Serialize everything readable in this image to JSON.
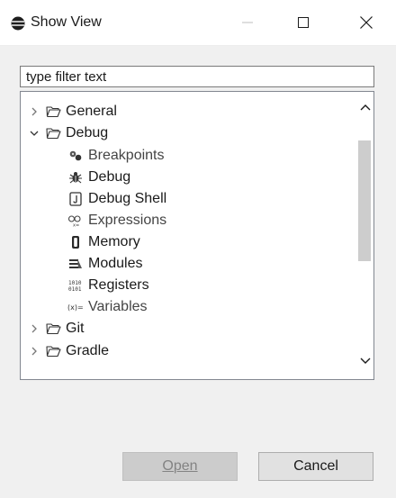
{
  "window": {
    "title": "Show View",
    "controls": {
      "minimize": "minimize",
      "maximize": "maximize",
      "close": "close"
    }
  },
  "filter": {
    "placeholder": "type filter text",
    "value": ""
  },
  "tree": {
    "items": [
      {
        "label": "General",
        "type": "folder",
        "expanded": false,
        "icon": "folder-icon"
      },
      {
        "label": "Debug",
        "type": "folder",
        "expanded": true,
        "icon": "folder-icon"
      },
      {
        "label": "Breakpoints",
        "type": "view",
        "icon": "breakpoints-icon"
      },
      {
        "label": "Debug",
        "type": "view",
        "icon": "debug-bug-icon"
      },
      {
        "label": "Debug Shell",
        "type": "view",
        "icon": "debug-shell-icon"
      },
      {
        "label": "Expressions",
        "type": "view",
        "icon": "expressions-icon"
      },
      {
        "label": "Memory",
        "type": "view",
        "icon": "memory-icon"
      },
      {
        "label": "Modules",
        "type": "view",
        "icon": "modules-icon"
      },
      {
        "label": "Registers",
        "type": "view",
        "icon": "registers-icon"
      },
      {
        "label": "Variables",
        "type": "view",
        "icon": "variables-icon"
      },
      {
        "label": "Git",
        "type": "folder",
        "expanded": false,
        "icon": "folder-icon"
      },
      {
        "label": "Gradle",
        "type": "folder",
        "expanded": false,
        "icon": "folder-icon"
      }
    ]
  },
  "buttons": {
    "open": "Open",
    "cancel": "Cancel",
    "open_enabled": false
  },
  "colors": {
    "titlebar": "#ffffff",
    "body": "#f0f0f0",
    "scroll_thumb": "#cdcdcd",
    "disabled_text": "#838383"
  }
}
